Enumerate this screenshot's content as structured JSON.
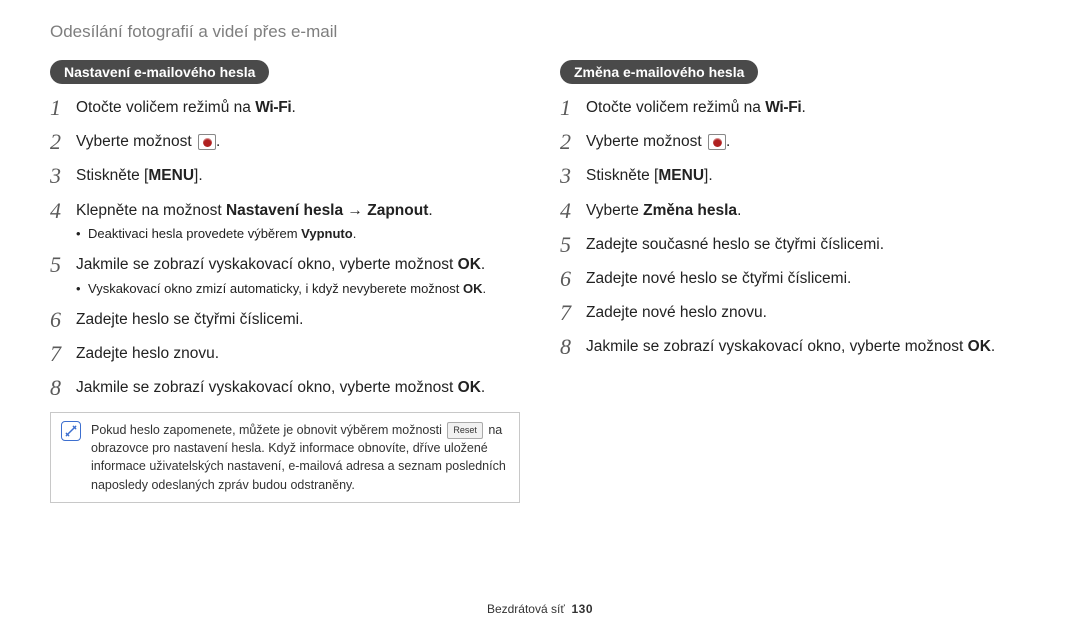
{
  "page_title": "Odesílání fotografií a videí přes e-mail",
  "wifi_label": "Wi-Fi",
  "menu_label": "MENU",
  "reset_label": "Reset",
  "icon_email_name": "email-app-icon",
  "left": {
    "pill": "Nastavení e-mailového hesla",
    "steps": {
      "1": {
        "pre": "Otočte voličem režimů na ",
        "tail": "."
      },
      "2": {
        "pre": "Vyberte možnost ",
        "tail": "."
      },
      "3": {
        "pre": "Stiskněte [",
        "tail": "]."
      },
      "4": {
        "pre": "Klepněte na možnost ",
        "b1": "Nastavení hesla",
        "arrow": " → ",
        "b2": "Zapnout",
        "tail": ".",
        "sub_pre": "Deaktivaci hesla provedete výběrem ",
        "sub_b": "Vypnuto",
        "sub_tail": "."
      },
      "5": {
        "pre": "Jakmile se zobrazí vyskakovací okno, vyberte možnost ",
        "b": "OK",
        "tail": ".",
        "sub_pre": "Vyskakovací okno zmizí automaticky, i když nevyberete možnost ",
        "sub_b": "OK",
        "sub_tail": "."
      },
      "6": {
        "text": "Zadejte heslo se čtyřmi číslicemi."
      },
      "7": {
        "text": "Zadejte heslo znovu."
      },
      "8": {
        "pre": "Jakmile se zobrazí vyskakovací okno, vyberte možnost ",
        "b": "OK",
        "tail": "."
      }
    },
    "note_pre": "Pokud heslo zapomenete, můžete je obnovit výběrem možnosti ",
    "note_tail": " na obrazovce pro nastavení hesla. Když informace obnovíte, dříve uložené informace uživatelských nastavení, e-mailová adresa a seznam posledních naposledy odeslaných zpráv budou odstraněny."
  },
  "right": {
    "pill": "Změna e-mailového hesla",
    "steps": {
      "1": {
        "pre": "Otočte voličem režimů na ",
        "tail": "."
      },
      "2": {
        "pre": "Vyberte možnost ",
        "tail": "."
      },
      "3": {
        "pre": "Stiskněte [",
        "tail": "]."
      },
      "4": {
        "pre": "Vyberte ",
        "b": "Změna hesla",
        "tail": "."
      },
      "5": {
        "text": "Zadejte současné heslo se čtyřmi číslicemi."
      },
      "6": {
        "text": "Zadejte nové heslo se čtyřmi číslicemi."
      },
      "7": {
        "text": "Zadejte nové heslo znovu."
      },
      "8": {
        "pre": "Jakmile se zobrazí vyskakovací okno, vyberte možnost ",
        "b": "OK",
        "tail": "."
      }
    }
  },
  "footer": {
    "label": "Bezdrátová síť",
    "page": "130"
  }
}
